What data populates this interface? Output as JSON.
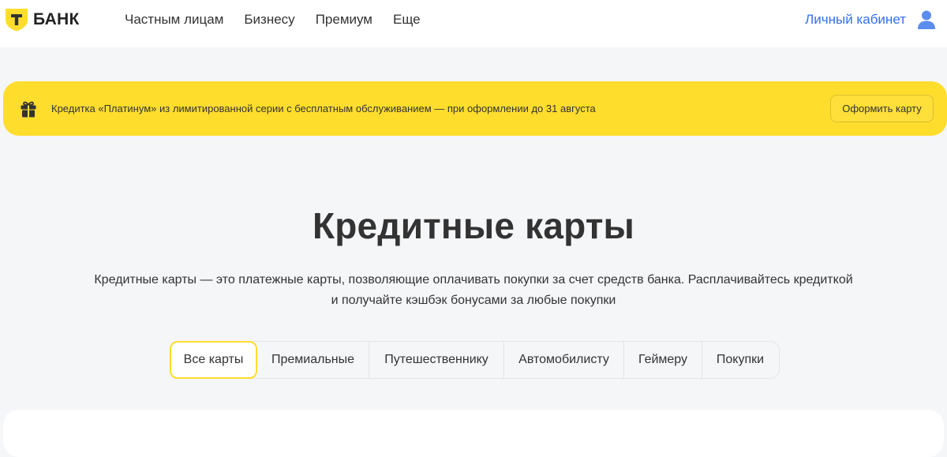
{
  "header": {
    "logo_text": "БАНК",
    "nav": [
      "Частным лицам",
      "Бизнесу",
      "Премиум",
      "Еще"
    ],
    "cabinet_label": "Личный кабинет"
  },
  "promo": {
    "text": "Кредитка «Платинум» из лимитированной серии с бесплатным обслуживанием — при оформлении до 31 августа",
    "button_label": "Оформить карту"
  },
  "main": {
    "title": "Кредитные карты",
    "description_line1": "Кредитные карты — это платежные карты, позволяющие оплачивать покупки за счет средств банка. Расплачивайтесь кредиткой",
    "description_line2": "и получайте кэшбэк бонусами за любые покупки",
    "tabs": [
      {
        "label": "Все карты",
        "active": true
      },
      {
        "label": "Премиальные",
        "active": false
      },
      {
        "label": "Путешественнику",
        "active": false
      },
      {
        "label": "Автомобилисту",
        "active": false
      },
      {
        "label": "Геймеру",
        "active": false
      },
      {
        "label": "Покупки",
        "active": false
      }
    ]
  },
  "colors": {
    "brand_yellow": "#ffdd2d",
    "link_blue": "#336fee",
    "background": "#f5f6f8"
  },
  "icons": {
    "logo": "t-bank-shield-logo",
    "user": "user-icon",
    "promo": "gift-icon"
  }
}
